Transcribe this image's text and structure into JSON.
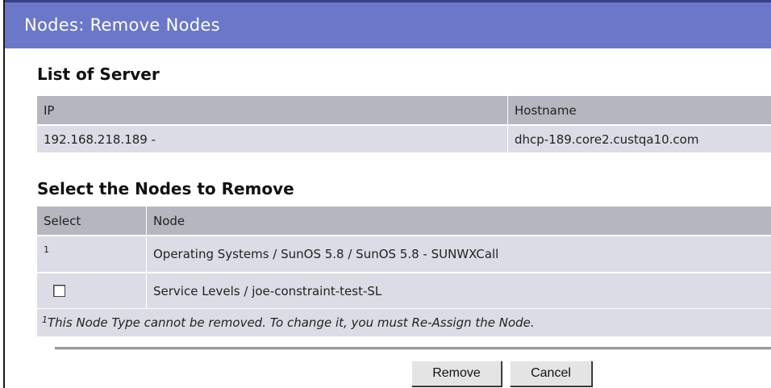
{
  "window": {
    "title": "Nodes: Remove Nodes"
  },
  "server_section": {
    "heading": "List of Server",
    "columns": [
      "IP",
      "Hostname"
    ],
    "rows": [
      {
        "ip": "192.168.218.189 -",
        "hostname": "dhcp-189.core2.custqa10.com"
      }
    ]
  },
  "nodes_section": {
    "heading": "Select the Nodes to Remove",
    "columns": [
      "Select",
      "Node"
    ],
    "rows": [
      {
        "select_marker": "1",
        "node": "Operating Systems / SunOS 5.8 / SunOS 5.8 - SUNWXCall",
        "checkbox": false
      },
      {
        "select_marker": "",
        "node": "Service Levels / joe-constraint-test-SL",
        "checkbox": true,
        "checked": false
      }
    ],
    "footnote_marker": "1",
    "footnote": "This Node Type cannot be removed. To change it, you must Re-Assign the Node."
  },
  "actions": {
    "remove_label": "Remove",
    "cancel_label": "Cancel"
  }
}
